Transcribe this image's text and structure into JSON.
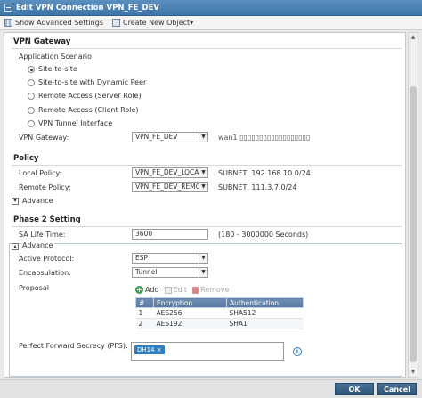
{
  "window": {
    "title": "Edit VPN Connection VPN_FE_DEV"
  },
  "toolbar": {
    "show_advanced": "Show Advanced Settings",
    "create_new": "Create New Object▾"
  },
  "vpn_gateway": {
    "section": "VPN Gateway",
    "app_scenario_label": "Application Scenario",
    "options": [
      "Site-to-site",
      "Site-to-site with Dynamic Peer",
      "Remote Access (Server Role)",
      "Remote Access (Client Role)",
      "VPN Tunnel Interface"
    ],
    "selected_index": 0,
    "gateway_label": "VPN Gateway:",
    "gateway_value": "VPN_FE_DEV",
    "gateway_info": "wan1 ▯▯▯▯▯▯▯▯▯▯▯▯▯▯▯▯▯▯"
  },
  "policy": {
    "section": "Policy",
    "local_label": "Local Policy:",
    "local_value": "VPN_FE_DEV_LOCAL",
    "local_info": "SUBNET, 192.168.10.0/24",
    "remote_label": "Remote Policy:",
    "remote_value": "VPN_FE_DEV_REMOTE",
    "remote_info": "SUBNET, 111.3.7.0/24",
    "advance_label": "Advance"
  },
  "phase2": {
    "section": "Phase 2 Setting",
    "sa_label": "SA Life Time:",
    "sa_value": "3600",
    "sa_range": "(180 - 3000000 Seconds)",
    "advance_label": "Advance",
    "active_protocol_label": "Active Protocol:",
    "active_protocol_value": "ESP",
    "encapsulation_label": "Encapsulation:",
    "encapsulation_value": "Tunnel",
    "proposal_label": "Proposal",
    "proposal_toolbar": {
      "add": "Add",
      "edit": "Edit",
      "remove": "Remove"
    },
    "proposal_columns": [
      "#",
      "Encryption",
      "Authentication"
    ],
    "proposals": [
      {
        "num": "1",
        "encryption": "AES256",
        "authentication": "SHA512"
      },
      {
        "num": "2",
        "encryption": "AES192",
        "authentication": "SHA1"
      }
    ],
    "pfs_label": "Perfect Forward Secrecy (PFS):",
    "pfs_value": "DH14"
  },
  "footer": {
    "ok": "OK",
    "cancel": "Cancel"
  }
}
